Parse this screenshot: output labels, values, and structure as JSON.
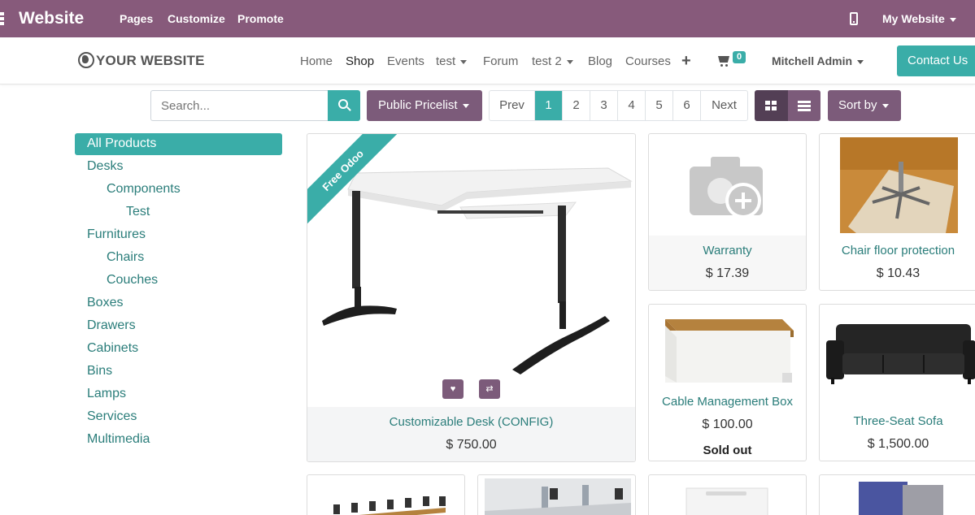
{
  "admin_bar": {
    "brand": "Website",
    "menu": [
      "Pages",
      "Customize",
      "Promote"
    ],
    "site_switcher": "My Website"
  },
  "header": {
    "logo": "YOUR WEBSITE",
    "nav": [
      "Home",
      "Shop",
      "Events",
      "test",
      "Forum",
      "test 2",
      "Blog",
      "Courses"
    ],
    "active_nav": "Shop",
    "cart_count": "0",
    "user": "Mitchell Admin",
    "contact_button": "Contact Us"
  },
  "toolbar": {
    "search_placeholder": "Search...",
    "pricelist": "Public Pricelist",
    "pager": [
      "Prev",
      "1",
      "2",
      "3",
      "4",
      "5",
      "6",
      "Next"
    ],
    "current_page": "1",
    "sort_label": "Sort by"
  },
  "categories": [
    "All Products",
    "Desks",
    "Components",
    "Test",
    "Furnitures",
    "Chairs",
    "Couches",
    "Boxes",
    "Drawers",
    "Cabinets",
    "Bins",
    "Lamps",
    "Services",
    "Multimedia"
  ],
  "selected_category": "All Products",
  "products": [
    {
      "name": "Customizable Desk (CONFIG)",
      "price": "$ 750.00",
      "ribbon": "Free Odoo"
    },
    {
      "name": "Warranty",
      "price": "$ 17.39"
    },
    {
      "name": "Chair floor protection",
      "price": "$ 10.43"
    },
    {
      "name": "Cable Management Box",
      "price": "$ 100.00",
      "status": "Sold out"
    },
    {
      "name": "Three-Seat Sofa",
      "price": "$ 1,500.00"
    }
  ],
  "colors": {
    "admin_bar": "#875a7b",
    "accent": "#3aada8",
    "button_purple": "#7c5b7a",
    "link": "#2a7d7a"
  }
}
